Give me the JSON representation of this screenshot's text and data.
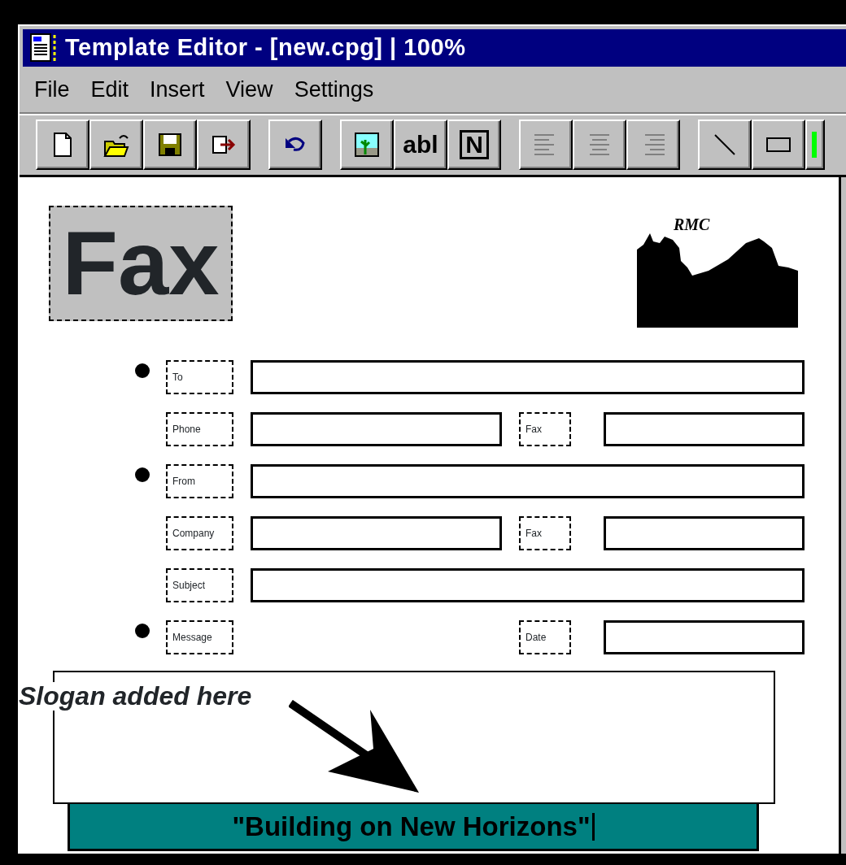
{
  "window": {
    "title": "Template Editor - [new.cpg] | 100%"
  },
  "menu": [
    "File",
    "Edit",
    "Insert",
    "View",
    "Settings"
  ],
  "toolbar": {
    "text_buttons": [
      "abl",
      "N"
    ]
  },
  "template": {
    "heading": "Fax",
    "logo_text": "RMC",
    "rows": [
      {
        "kind": "full",
        "bullet": true,
        "label": "To"
      },
      {
        "kind": "split",
        "bullet": false,
        "label": "Phone",
        "second_label": "Fax"
      },
      {
        "kind": "full",
        "bullet": true,
        "label": "From"
      },
      {
        "kind": "split",
        "bullet": false,
        "label": "Company",
        "second_label": "Fax"
      },
      {
        "kind": "full",
        "bullet": false,
        "label": "Subject"
      },
      {
        "kind": "side-only",
        "bullet": true,
        "label": "Message",
        "second_label": "Date"
      }
    ],
    "annotation": "Slogan added here",
    "slogan": "\"Building on New Horizons\""
  }
}
